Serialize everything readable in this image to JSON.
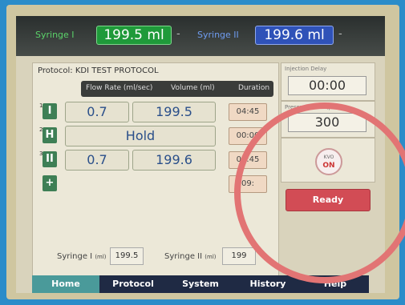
{
  "header": {
    "syringe1_label": "Syringe I",
    "syringe1_value": "199.5 ml",
    "sep": "-",
    "syringe2_label": "Syringe II",
    "syringe2_value": "199.6 ml",
    "sep2": "-"
  },
  "protocol": {
    "title": "Protocol: KDI TEST PROTOCOL",
    "columns": [
      "Flow Rate (ml/sec)",
      "Volume (ml)",
      "Duration"
    ],
    "phases": [
      {
        "num": "1",
        "icon": "I",
        "rate": "0.7",
        "volume": "199.5",
        "duration": "04:45"
      },
      {
        "num": "2",
        "icon": "H",
        "hold": "Hold",
        "duration": "00:00"
      },
      {
        "num": "3",
        "icon": "II",
        "rate": "0.7",
        "volume": "199.6",
        "duration": "04:45"
      }
    ],
    "add_icon": "+",
    "extra_duration": "09:",
    "footer": {
      "syr1_label": "Syringe I",
      "syr1_unit": "(ml)",
      "syr1_value": "199.5",
      "syr2_label": "Syringe II",
      "syr2_unit": "(ml)",
      "syr2_value": "199"
    }
  },
  "right": {
    "injection_delay_label": "Injection Delay",
    "injection_delay_value": "00:00",
    "pressure_limit_label": "Pressure Limit (psi)",
    "pressure_limit_value": "300",
    "kvo_top": "KVO",
    "kvo_bottom": "ON",
    "ready_label": "Ready"
  },
  "tabs": [
    "Home",
    "Protocol",
    "System",
    "History",
    "Help"
  ],
  "colors": {
    "syringe1_bg": "#1f9a3a",
    "syringe2_bg": "#2f52b8",
    "ready": "#d24c55",
    "active_tab": "#4a9a9a",
    "annotation_ring": "#e27474"
  }
}
